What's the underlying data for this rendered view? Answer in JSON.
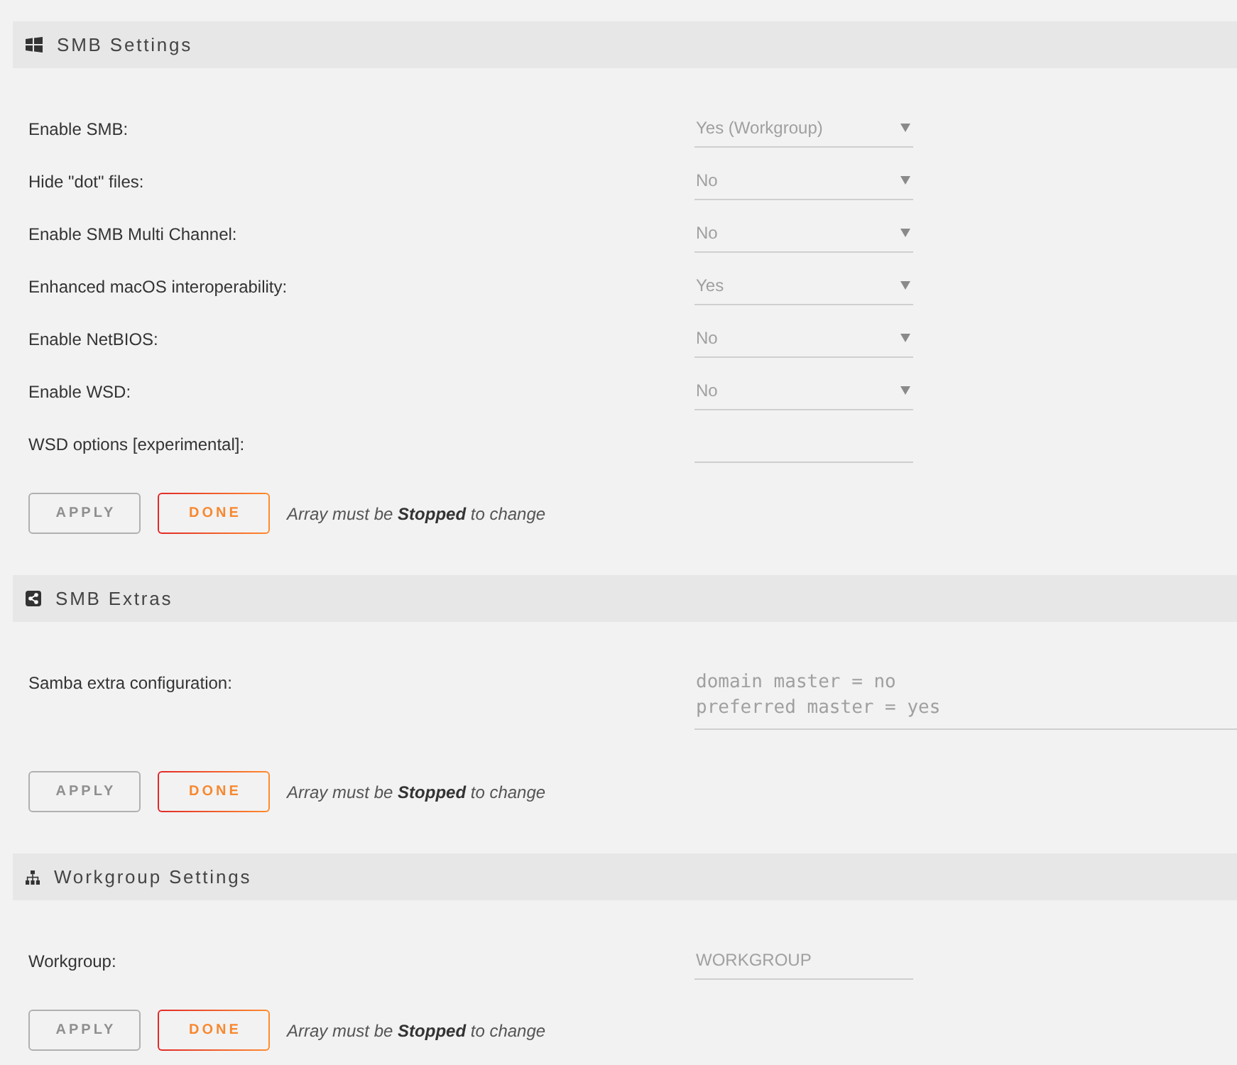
{
  "sections": [
    {
      "title": "SMB Settings",
      "rows": [
        {
          "label": "Enable SMB:",
          "kind": "select",
          "value": "Yes (Workgroup)",
          "disabled": true
        },
        {
          "label": "Hide \"dot\" files:",
          "kind": "select",
          "value": "No",
          "disabled": true
        },
        {
          "label": "Enable SMB Multi Channel:",
          "kind": "select",
          "value": "No",
          "disabled": true
        },
        {
          "label": "Enhanced macOS interoperability:",
          "kind": "select",
          "value": "Yes",
          "disabled": true
        },
        {
          "label": "Enable NetBIOS:",
          "kind": "select",
          "value": "No",
          "disabled": true
        },
        {
          "label": "Enable WSD:",
          "kind": "select",
          "value": "No",
          "disabled": true
        },
        {
          "label": "WSD options [experimental]:",
          "kind": "input",
          "disabled": true
        }
      ],
      "buttons": [
        {
          "label": "APPLY",
          "disabled": true
        },
        {
          "label": "DONE",
          "disabled": false
        }
      ],
      "note": "Array must be **Stopped** to change"
    },
    {
      "title": "SMB Extras",
      "rows": [
        {
          "label": "Samba extra configuration:",
          "kind": "textarea",
          "value": "domain master = no\npreferred master = yes",
          "disabled": true
        }
      ],
      "buttons": [
        {
          "label": "APPLY",
          "disabled": true
        },
        {
          "label": "DONE",
          "disabled": false
        }
      ],
      "note": "Array must be **Stopped** to change"
    },
    {
      "title": "Workgroup Settings",
      "rows": [
        {
          "label": "Workgroup:",
          "kind": "input",
          "value": "WORKGROUP",
          "disabled": true
        }
      ],
      "buttons": [
        {
          "label": "APPLY",
          "disabled": true
        },
        {
          "label": "DONE",
          "disabled": false
        }
      ],
      "note": "Array must be **Stopped** to change"
    }
  ]
}
